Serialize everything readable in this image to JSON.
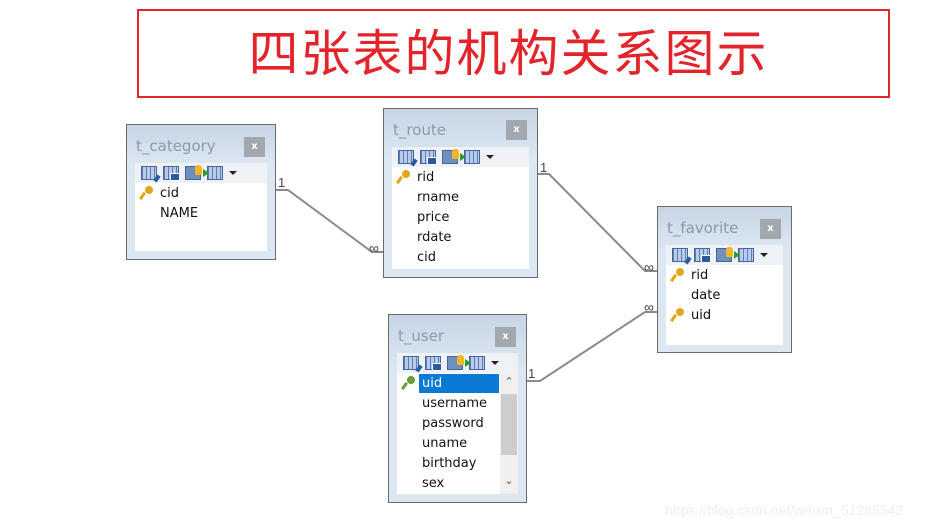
{
  "title": "四张表的机构关系图示",
  "toolbar_icons": [
    "edit-table-icon",
    "table-properties-icon",
    "primary-key-icon",
    "insert-row-icon",
    "dropdown-arrow-icon"
  ],
  "close_label": "x",
  "tables": {
    "t_category": {
      "name": "t_category",
      "fields": [
        {
          "name": "cid",
          "key": true
        },
        {
          "name": "NAME",
          "key": false
        }
      ]
    },
    "t_route": {
      "name": "t_route",
      "fields": [
        {
          "name": "rid",
          "key": true
        },
        {
          "name": "rname",
          "key": false
        },
        {
          "name": "price",
          "key": false
        },
        {
          "name": "rdate",
          "key": false
        },
        {
          "name": "cid",
          "key": false
        }
      ]
    },
    "t_favorite": {
      "name": "t_favorite",
      "fields": [
        {
          "name": "rid",
          "key": true
        },
        {
          "name": "date",
          "key": false
        },
        {
          "name": "uid",
          "key": true
        }
      ]
    },
    "t_user": {
      "name": "t_user",
      "selected_field": "uid",
      "fields": [
        {
          "name": "uid",
          "key": true
        },
        {
          "name": "username",
          "key": false
        },
        {
          "name": "password",
          "key": false
        },
        {
          "name": "uname",
          "key": false
        },
        {
          "name": "birthday",
          "key": false
        },
        {
          "name": "sex",
          "key": false
        }
      ]
    }
  },
  "relations": [
    {
      "from": "t_category.cid",
      "to": "t_route.cid",
      "from_card": "1",
      "to_card": "∞"
    },
    {
      "from": "t_route.rid",
      "to": "t_favorite.rid",
      "from_card": "1",
      "to_card": "∞"
    },
    {
      "from": "t_user.uid",
      "to": "t_favorite.uid",
      "from_card": "1",
      "to_card": "∞"
    }
  ],
  "watermark": "https://blog.csdn.net/weixin_51285542"
}
